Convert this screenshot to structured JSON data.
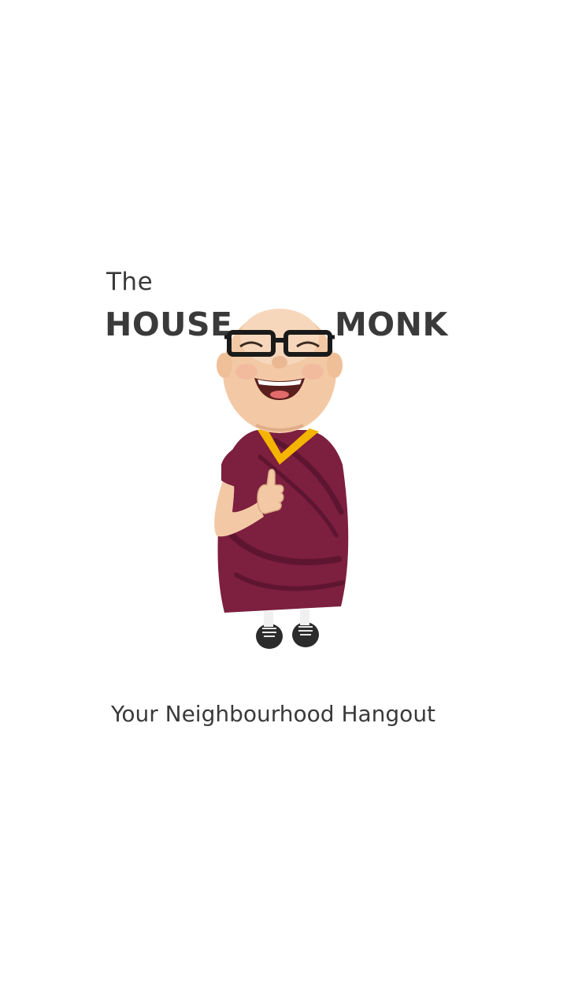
{
  "logo": {
    "the": "The",
    "house": "HOUSE",
    "monk": "MONK"
  },
  "mascot_icon": "monk-mascot-icon",
  "tagline": "Your Neighbourhood Hangout",
  "colors": {
    "background": "#ffffff",
    "text": "#3a3a3a",
    "robe": "#7d1f3f",
    "robe_dark": "#5e1530",
    "collar": "#f5b400",
    "skin": "#f3c9a5"
  }
}
